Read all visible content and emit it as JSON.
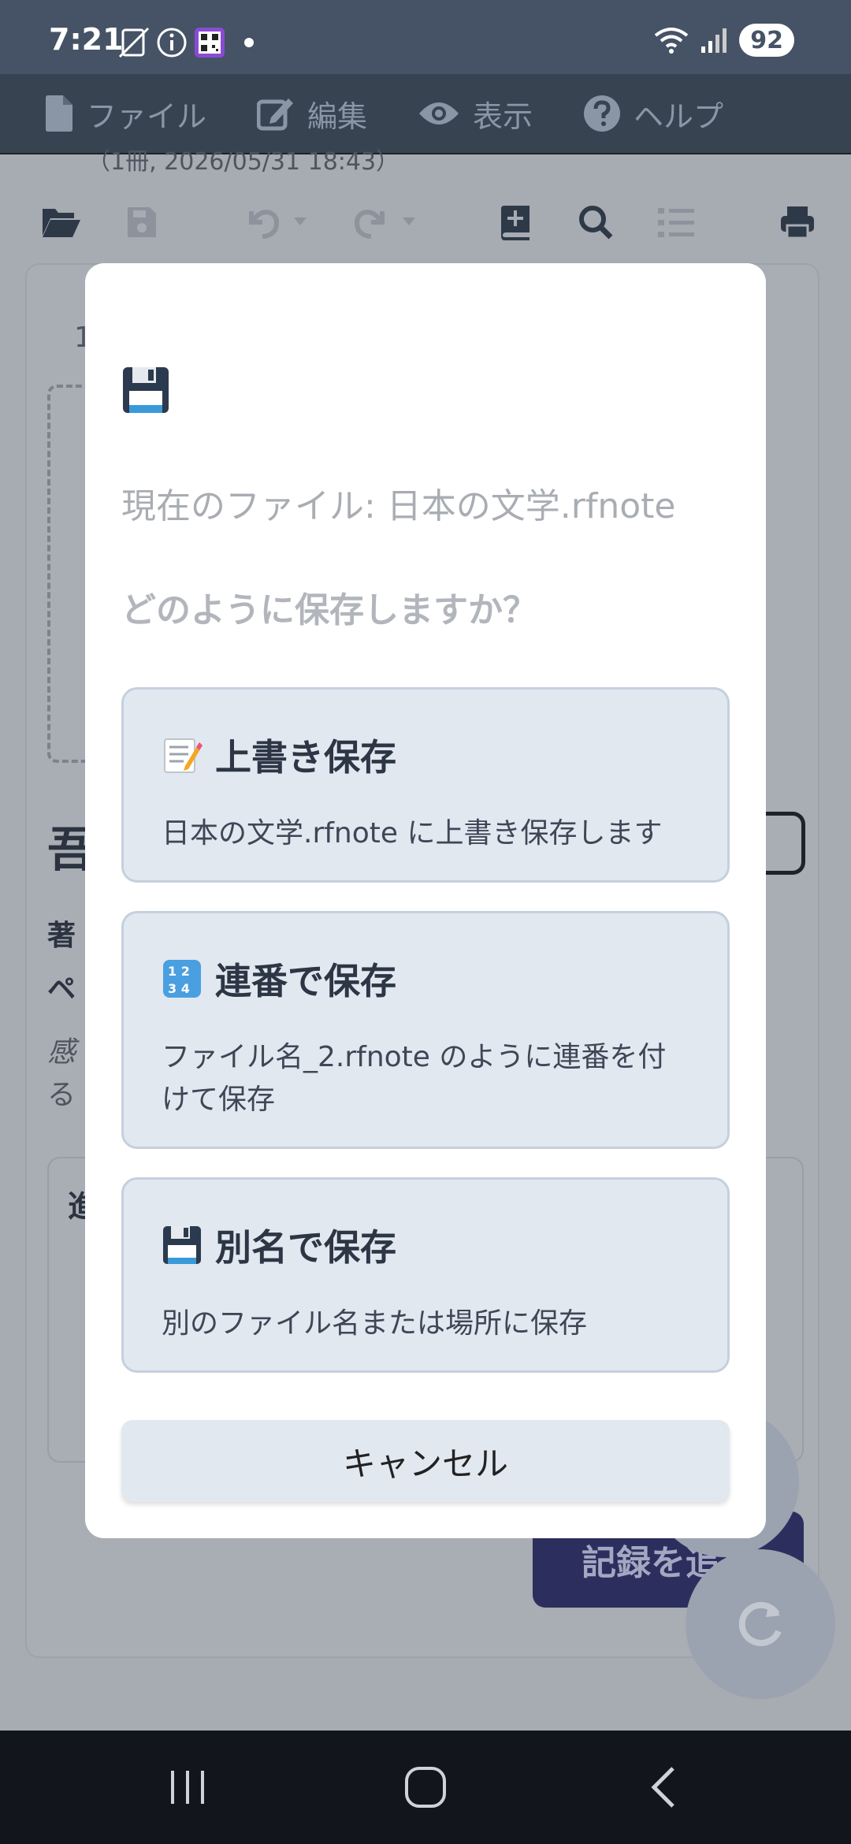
{
  "status_bar": {
    "time": "7:21",
    "battery": "92",
    "icons": [
      "no-sim-icon",
      "info-icon",
      "qr-icon",
      "notification-dot",
      "wifi-icon",
      "signal-icon",
      "battery-icon"
    ]
  },
  "menu": {
    "items": [
      {
        "label": "ファイル",
        "icon": "file-icon"
      },
      {
        "label": "編集",
        "icon": "edit-icon"
      },
      {
        "label": "表示",
        "icon": "eye-icon"
      },
      {
        "label": "ヘルプ",
        "icon": "help-icon"
      }
    ]
  },
  "background": {
    "subtitle": "（1冊, 2026/05/31 18:43）",
    "row_number": "1",
    "title_partial": "吾",
    "line1_partial": "著",
    "line2_partial": "ペ",
    "line3_partial": "感",
    "line4_partial": "る",
    "input_partial": "進",
    "add_button": "記録を追加"
  },
  "dialog": {
    "icon": "floppy-disk-icon",
    "current_file": "現在のファイル: 日本の文学.rfnote",
    "question": "どのように保存しますか？",
    "options": [
      {
        "icon": "memo-icon",
        "title": "上書き保存",
        "desc": "日本の文学.rfnote に上書き保存します"
      },
      {
        "icon": "numbers-icon",
        "title": "連番で保存",
        "desc": "ファイル名_2.rfnote のように連番を付けて保存"
      },
      {
        "icon": "floppy-disk-icon",
        "title": "別名で保存",
        "desc": "別のファイル名または場所に保存"
      }
    ],
    "cancel": "キャンセル"
  },
  "colors": {
    "overlay": "#a7abb2",
    "menubar": "#384352",
    "statusbar": "#465366",
    "option_bg": "#e2e8f0",
    "option_border": "#c5d0de"
  }
}
